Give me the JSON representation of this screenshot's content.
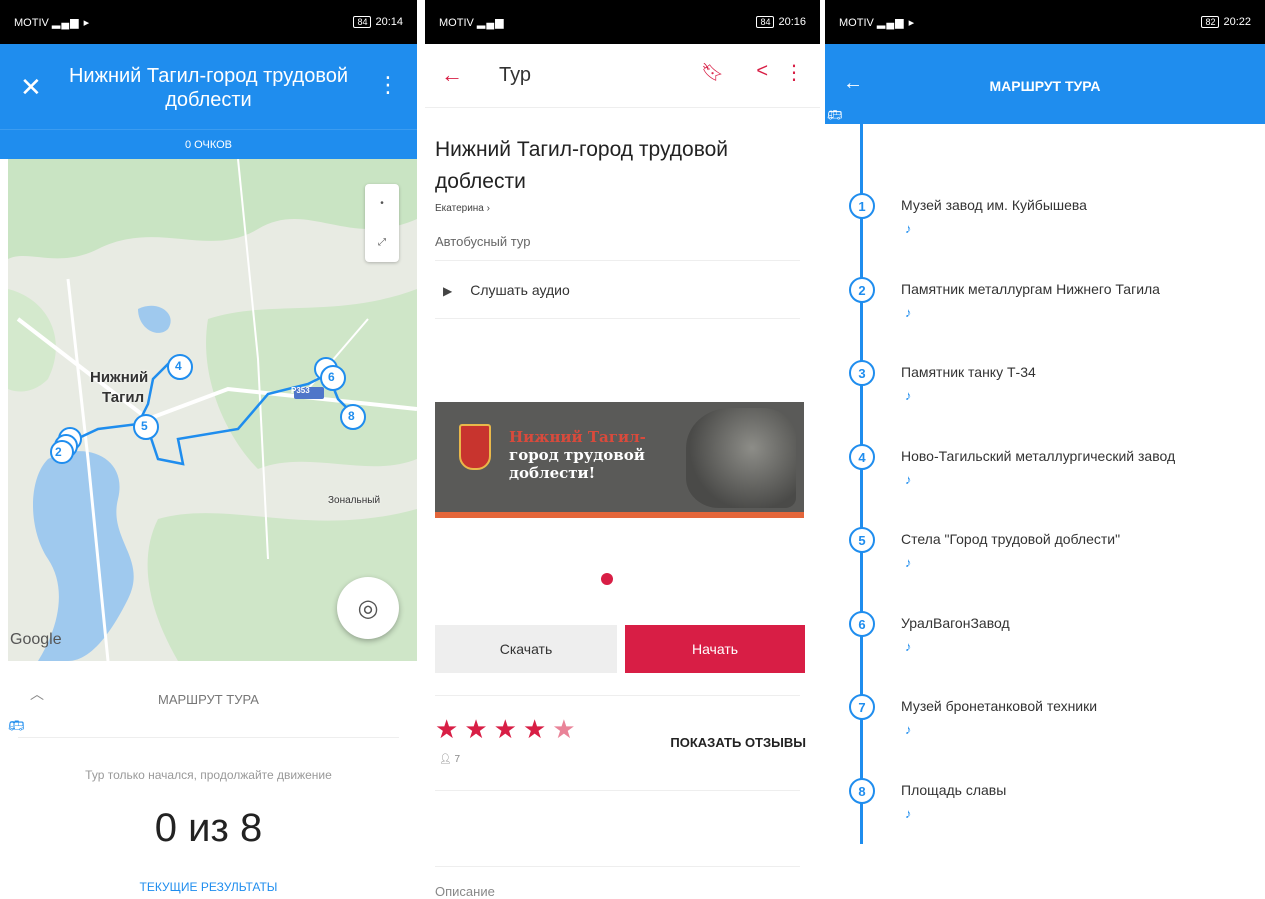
{
  "screen1": {
    "status": {
      "carrier": "MOTIV",
      "time": "20:14",
      "battery": "84"
    },
    "title": "Нижний Тагил-город трудовой доблести",
    "points": "0 ОЧКОВ",
    "map": {
      "city_label_1": "Нижний",
      "city_label_2": "Тагил",
      "road_label": "Р353",
      "place_label": "Зональный",
      "google": "Google",
      "markers": [
        "2",
        "4",
        "5",
        "6",
        "8"
      ]
    },
    "route_header": "МАРШРУТ ТУРА",
    "status_text": "Тур только начался, продолжайте движение",
    "progress": "0 из 8",
    "results_link": "ТЕКУЩИЕ РЕЗУЛЬТАТЫ"
  },
  "screen2": {
    "status": {
      "carrier": "MOTIV",
      "time": "20:16",
      "battery": "84"
    },
    "toolbar_title": "Тур",
    "tour_title": "Нижний Тагил-город трудовой доблести",
    "author": "Екатерина",
    "tour_type": "Автобусный тур",
    "listen_audio": "Слушать аудио",
    "banner": {
      "line1": "Нижний Тагил-",
      "line2": "город трудовой",
      "line3": "доблести!"
    },
    "download_label": "Скачать",
    "start_label": "Начать",
    "rating": 4.5,
    "reviewers": "7",
    "show_reviews": "ПОКАЗАТЬ ОТЗЫВЫ",
    "description_label": "Описание"
  },
  "screen3": {
    "status": {
      "carrier": "MOTIV",
      "time": "20:22",
      "battery": "82"
    },
    "title": "МАРШРУТ ТУРА",
    "stops": [
      {
        "num": "1",
        "name": "Музей завод им. Куйбышева"
      },
      {
        "num": "2",
        "name": "Памятник металлургам Нижнего Тагила"
      },
      {
        "num": "3",
        "name": "Памятник танку Т-34"
      },
      {
        "num": "4",
        "name": "Ново-Тагильский металлургический завод"
      },
      {
        "num": "5",
        "name": "Стела \"Город трудовой доблести\""
      },
      {
        "num": "6",
        "name": "УралВагонЗавод"
      },
      {
        "num": "7",
        "name": "Музей бронетанковой техники"
      },
      {
        "num": "8",
        "name": "Площадь славы"
      }
    ]
  },
  "colors": {
    "primary_blue": "#1f8dee",
    "accent_red": "#d81e45"
  }
}
